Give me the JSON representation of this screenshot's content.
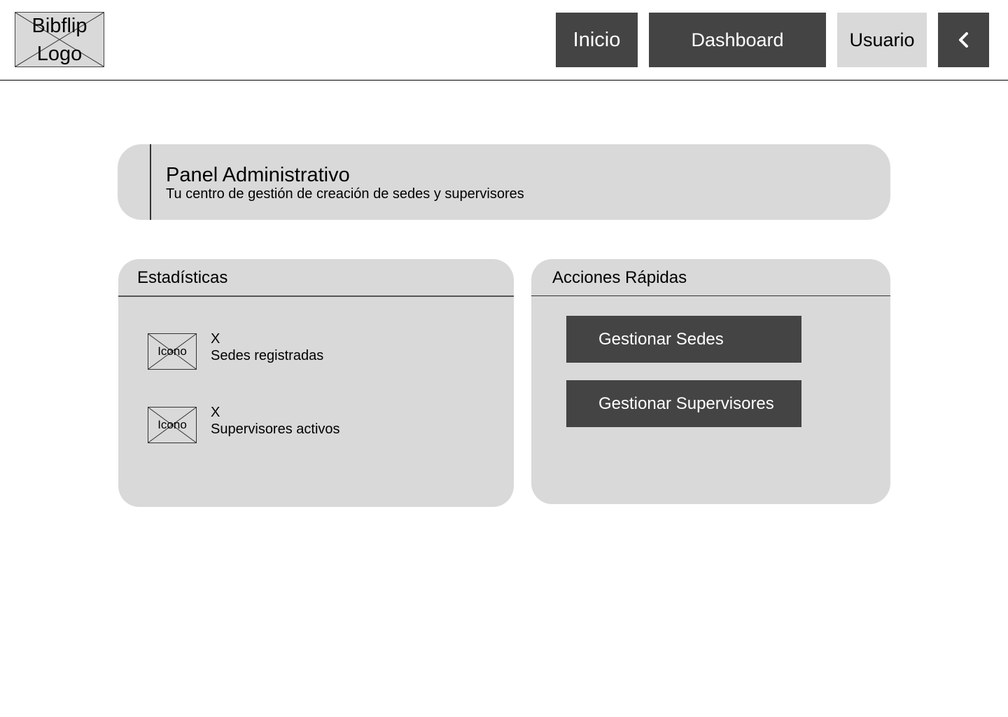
{
  "header": {
    "logo_text": "Bibflip\nLogo",
    "nav": {
      "inicio": "Inicio",
      "dashboard": "Dashboard",
      "usuario": "Usuario"
    },
    "back_icon": "chevron-left-icon"
  },
  "panel": {
    "title": "Panel Administrativo",
    "subtitle": "Tu centro de gestión de creación de sedes y supervisores"
  },
  "stats": {
    "title": "Estadísticas",
    "items": [
      {
        "icon_label": "Icono",
        "value": "X",
        "label": "Sedes registradas"
      },
      {
        "icon_label": "Icono",
        "value": "X",
        "label": "Supervisores activos"
      }
    ]
  },
  "actions": {
    "title": "Acciones Rápidas",
    "buttons": [
      {
        "label": "Gestionar Sedes"
      },
      {
        "label": "Gestionar Supervisores"
      }
    ]
  },
  "colors": {
    "dark": "#444444",
    "light": "#d9d9d9"
  }
}
